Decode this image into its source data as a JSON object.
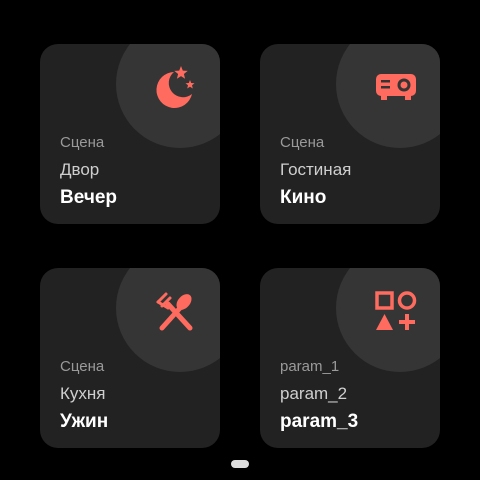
{
  "colors": {
    "background": "#000000",
    "tile": "#222222",
    "icon_circle": "#353535",
    "accent": "#FF6B5E",
    "text_primary": "#FFFFFF",
    "text_secondary": "#CFCFCF",
    "text_muted": "#9A9A9A"
  },
  "tiles": [
    {
      "icon": "night-moon-stars-icon",
      "line1": "Сцена",
      "line2": "Двор",
      "line3": "Вечер"
    },
    {
      "icon": "projector-icon",
      "line1": "Сцена",
      "line2": "Гостиная",
      "line3": "Кино"
    },
    {
      "icon": "fork-spoon-icon",
      "line1": "Сцена",
      "line2": "Кухня",
      "line3": "Ужин"
    },
    {
      "icon": "shapes-icon",
      "line1": "param_1",
      "line2": "param_2",
      "line3": "param_3"
    }
  ],
  "pager": {
    "current_page": 1
  }
}
